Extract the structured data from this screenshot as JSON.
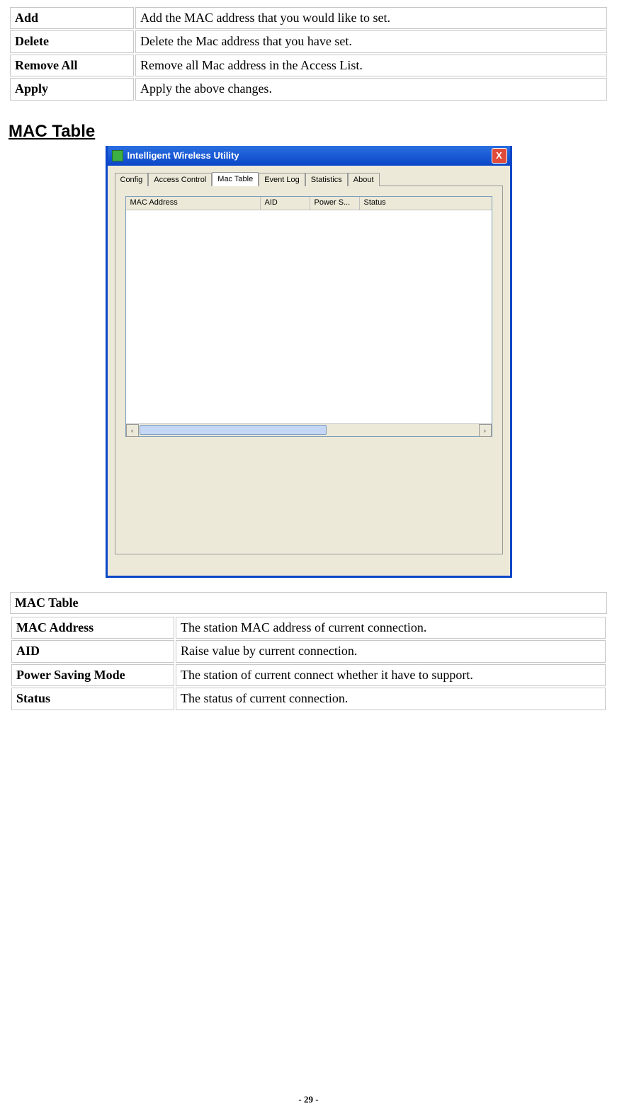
{
  "actions": {
    "add": {
      "label": "Add",
      "desc": "Add the MAC address that you would like to set."
    },
    "delete": {
      "label": "Delete",
      "desc": "Delete the Mac address that you have set."
    },
    "removeAll": {
      "label": "Remove All",
      "desc": "Remove all Mac address in the Access List."
    },
    "apply": {
      "label": "Apply",
      "desc": "Apply the above changes."
    }
  },
  "section_heading": "MAC Table",
  "window": {
    "title": "Intelligent Wireless Utility",
    "close": "X",
    "tabs": {
      "config": "Config",
      "access": "Access Control",
      "mac": "Mac Table",
      "event": "Event Log",
      "stats": "Statistics",
      "about": "About"
    },
    "cols": {
      "mac": "MAC Address",
      "aid": "AID",
      "power": "Power S...",
      "status": "Status"
    },
    "scroll_left": "‹",
    "scroll_right": "›"
  },
  "info": {
    "header": "MAC Table",
    "mac": {
      "label": "MAC Address",
      "desc": "The station MAC address of current connection."
    },
    "aid": {
      "label": "AID",
      "desc": "Raise value by current connection."
    },
    "psm": {
      "label": "Power Saving Mode",
      "desc": "The station of current connect whether it have to support."
    },
    "status": {
      "label": "Status",
      "desc": "The status of current connection."
    }
  },
  "page_number": "- 29 -"
}
